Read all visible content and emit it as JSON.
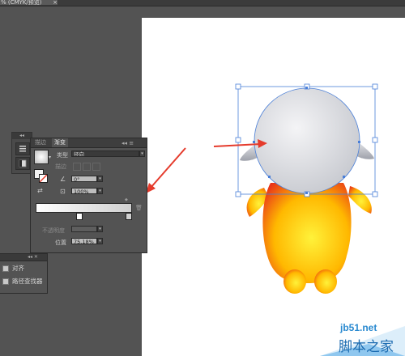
{
  "window": {
    "doc_tab": "% (CMYK/预览)",
    "close_glyph": "×"
  },
  "tool_strip": {
    "collapse_glyph": "◂◂"
  },
  "gradient_panel": {
    "tabs": {
      "stroke": "描边",
      "gradient": "渐变"
    },
    "header_controls": "◂◂ ≡",
    "type_label": "类型",
    "type_value": "径向",
    "stroke_label": "描边",
    "angle_value": "0°",
    "aspect_value": "100%",
    "opacity_label": "不透明度",
    "location_label": "位置",
    "location_value": "75.18%",
    "gradient_colors": [
      "#ffffff",
      "#cfcfcf"
    ]
  },
  "align_panel": {
    "header_controls": "◂◂ ✕",
    "items": [
      {
        "label": "对齐"
      },
      {
        "label": "路径查找器"
      }
    ]
  },
  "artwork": {
    "head_colors": [
      "#f4f4f6",
      "#c9cbd1"
    ],
    "body_colors": [
      "#fff23a",
      "#ffb800",
      "#e8331a"
    ],
    "arrow_color": "#e53b2c",
    "selection_color": "#4a7fd8"
  },
  "watermark": {
    "site": "jb51.net",
    "brand": "脚本之家"
  }
}
